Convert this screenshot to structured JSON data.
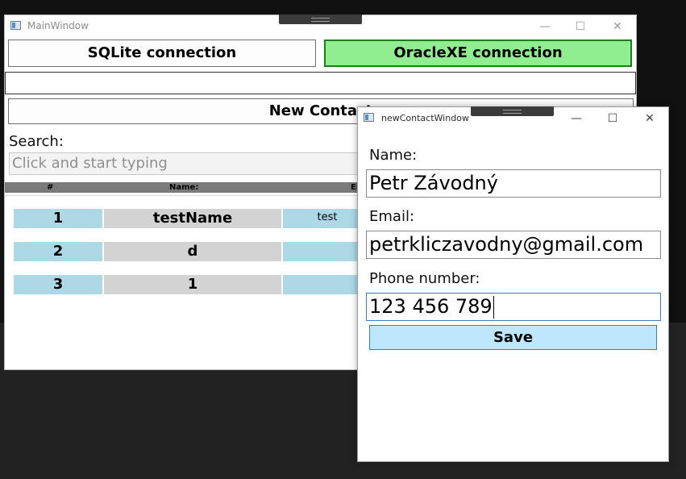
{
  "main_window": {
    "title": "MainWindow",
    "controls": {
      "minimize": "—",
      "maximize": "☐",
      "close": "✕"
    },
    "sqlite_button": "SQLite connection",
    "oracle_button": "OracleXE connection",
    "new_contact_button": "New Contact",
    "search": {
      "label": "Search:",
      "placeholder": "Click and start typing"
    },
    "grid": {
      "columns": [
        "#",
        "Name:",
        "Email:"
      ],
      "rows": [
        {
          "id": "1",
          "name": "testName",
          "email": "test"
        },
        {
          "id": "2",
          "name": "d",
          "email": ""
        },
        {
          "id": "3",
          "name": "1",
          "email": ""
        }
      ]
    },
    "colors": {
      "active_connection": "#90ee90",
      "id_cell": "#add8e6",
      "name_cell": "#d3d3d3"
    }
  },
  "new_contact_window": {
    "title": "newContactWindow",
    "controls": {
      "minimize": "—",
      "maximize": "☐",
      "close": "✕"
    },
    "name_label": "Name:",
    "name_value": "Petr Závodný",
    "email_label": "Email:",
    "email_value": "petrkliczavodny@gmail.com",
    "phone_label": "Phone number:",
    "phone_value": "123 456 789",
    "save_button": "Save",
    "colors": {
      "save_button": "#bee6fd",
      "focus_border": "#3b7fc4"
    }
  }
}
